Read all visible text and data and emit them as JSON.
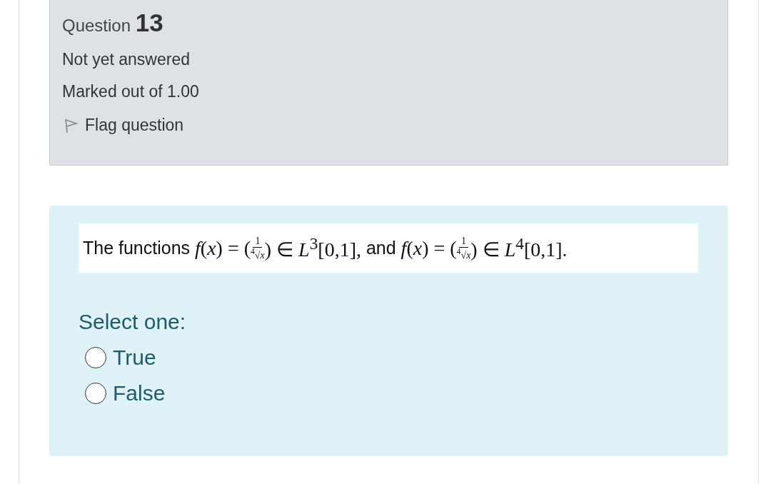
{
  "info": {
    "label": "Question",
    "number": "13",
    "status": "Not yet answered",
    "marks": "Marked out of 1.00",
    "flag": {
      "label": "Flag question",
      "flagged": false
    }
  },
  "question": {
    "segments": [
      {
        "kind": "text",
        "text": "The functions "
      },
      {
        "kind": "math",
        "text": "f(x) = ("
      },
      {
        "kind": "fraction",
        "numerator": "1",
        "denominator": "$^{4}$√*x*"
      },
      {
        "kind": "math",
        "text": ") ∈ *L*$^{3}$[0,1],"
      },
      {
        "kind": "text",
        "text": " and "
      },
      {
        "kind": "math",
        "text": "f(x) = ("
      },
      {
        "kind": "fraction",
        "numerator": "1",
        "denominator": "$^{4}$√*x*"
      },
      {
        "kind": "math",
        "text": ") ∈ *L*$^{4}$[0,1]."
      }
    ]
  },
  "prompt": "Select one:",
  "options": [
    {
      "label": "True",
      "selected": false
    },
    {
      "label": "False",
      "selected": false
    }
  ]
}
